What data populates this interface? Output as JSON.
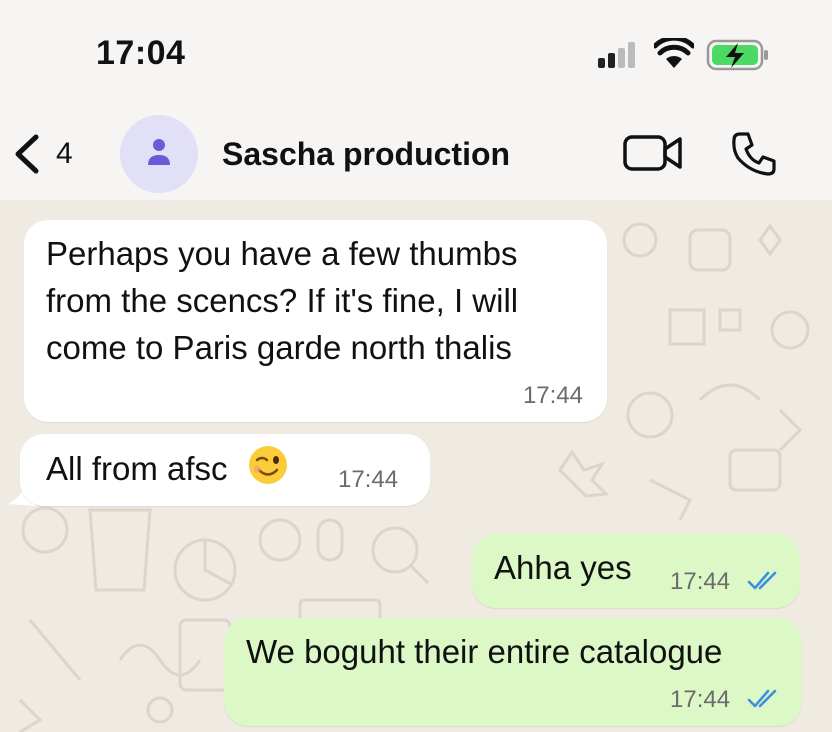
{
  "status_bar": {
    "time": "17:04"
  },
  "header": {
    "back_count": "4",
    "contact_name": "Sascha production",
    "icons": [
      "chevron-left-icon",
      "person-icon",
      "video-camera-icon",
      "phone-icon"
    ]
  },
  "messages": [
    {
      "direction": "incoming",
      "lines": [
        "Perhaps you have a few thumbs",
        "from the scencs? If it's fine, I will",
        "come to Paris garde north thalis"
      ],
      "time": "17:44"
    },
    {
      "direction": "incoming",
      "text": "All from afsc",
      "emoji": "winking-face-emoji",
      "time": "17:44"
    },
    {
      "direction": "outgoing",
      "text": "Ahha yes",
      "time": "17:44",
      "status": "read"
    },
    {
      "direction": "outgoing",
      "text": "We boguht their entire catalogue",
      "time": "17:44",
      "status": "read"
    }
  ],
  "colors": {
    "chat_background": "#efeae2",
    "incoming_bubble": "#ffffff",
    "outgoing_bubble": "#dcf8c6",
    "read_ticks": "#3d8fe0",
    "battery_fill": "#4cd964"
  }
}
